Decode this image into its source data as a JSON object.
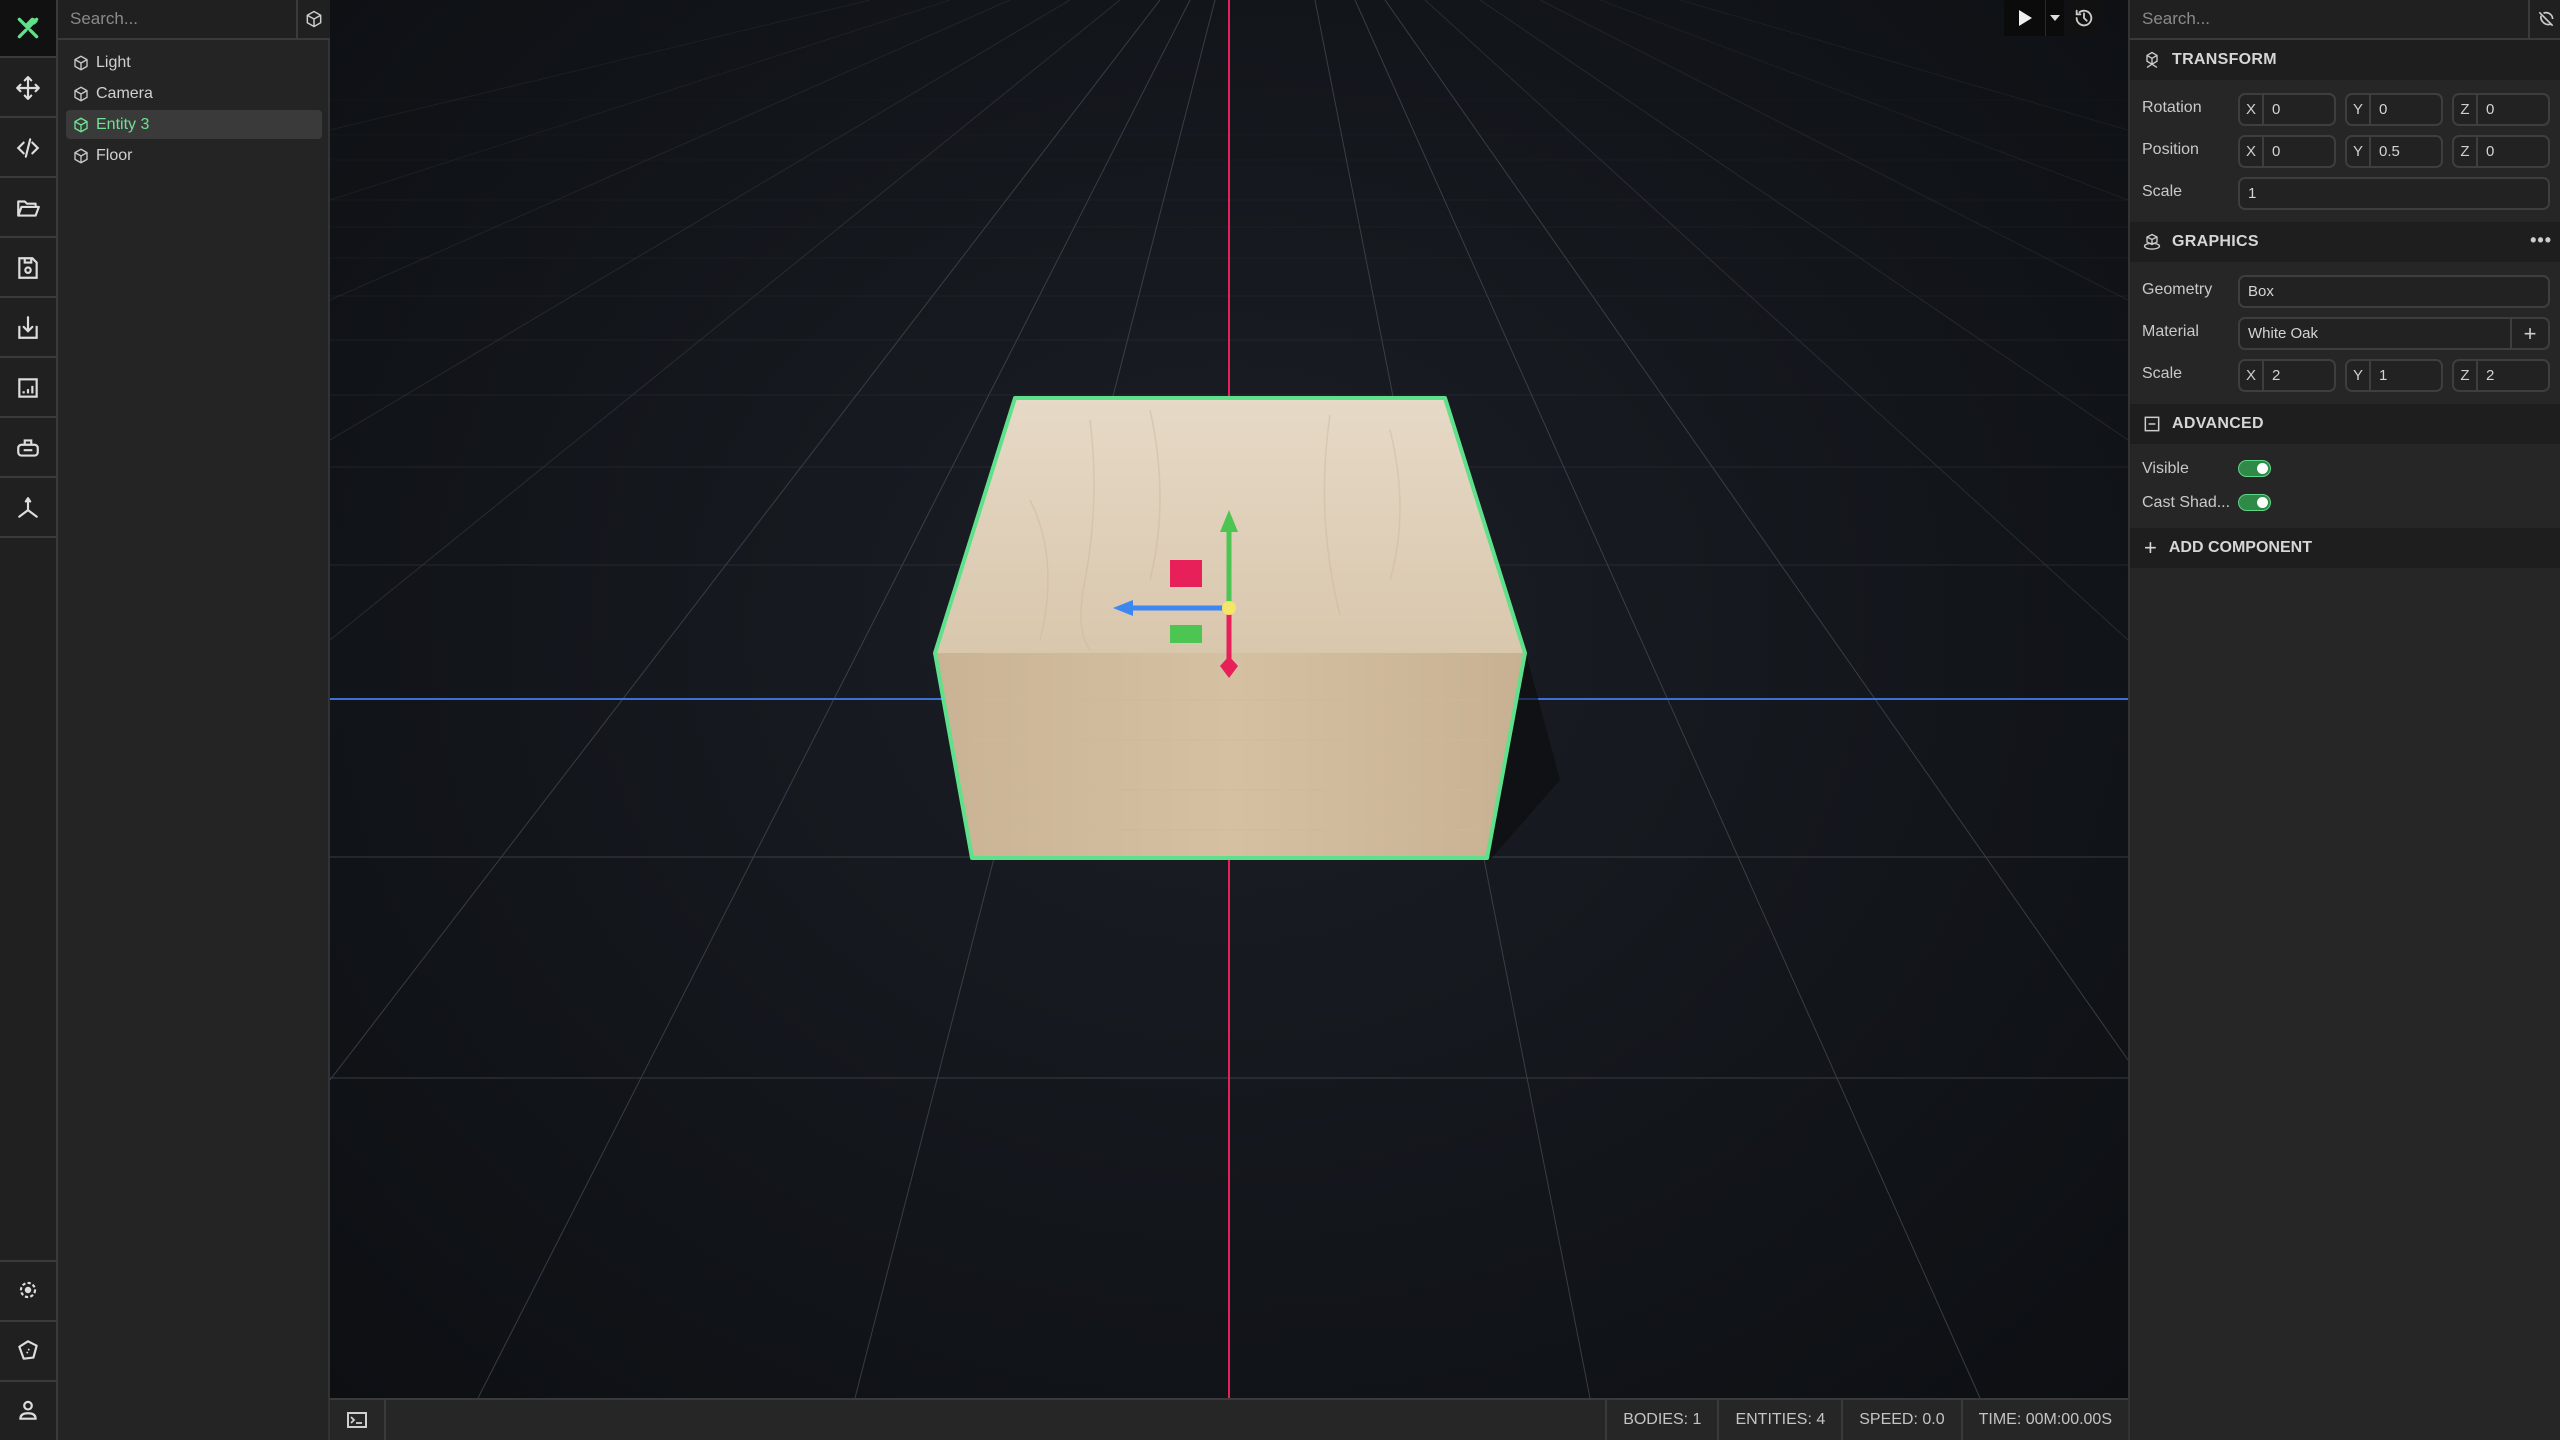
{
  "left_rail": {
    "top_items": [
      {
        "name": "build-tools",
        "icon": "hammer-wrench-icon",
        "active": true
      },
      {
        "name": "transform",
        "icon": "move-arrows-icon"
      },
      {
        "name": "code",
        "icon": "code-icon"
      },
      {
        "name": "open",
        "icon": "folder-open-icon"
      },
      {
        "name": "save",
        "icon": "floppy-disk-icon"
      },
      {
        "name": "import",
        "icon": "import-icon"
      },
      {
        "name": "stats",
        "icon": "chart-icon"
      },
      {
        "name": "vr",
        "icon": "vr-headset-icon"
      },
      {
        "name": "axes",
        "icon": "axes-icon"
      }
    ],
    "bottom_items": [
      {
        "name": "settings",
        "icon": "gear-icon"
      },
      {
        "name": "tag",
        "icon": "tag-icon"
      },
      {
        "name": "account",
        "icon": "user-icon"
      }
    ]
  },
  "hierarchy": {
    "search_placeholder": "Search...",
    "add_entity_icon": "cube-icon",
    "items": [
      {
        "label": "Light",
        "selected": false
      },
      {
        "label": "Camera",
        "selected": false
      },
      {
        "label": "Entity 3",
        "selected": true
      },
      {
        "label": "Floor",
        "selected": false
      }
    ]
  },
  "viewport": {
    "toolbar": {
      "play_icon": "play-icon",
      "dropdown_icon": "caret-down-icon",
      "history_icon": "history-icon"
    },
    "selected_object": "Entity 3",
    "colors": {
      "x_axis": "#e8205a",
      "y_axis": "#4cc552",
      "z_axis": "#3d87f0",
      "selection_outline": "#5fe08a",
      "center": "#f5e66a"
    }
  },
  "status_bar": {
    "terminal_icon": "terminal-icon",
    "stats": [
      {
        "label": "BODIES: 1"
      },
      {
        "label": "ENTITIES: 4"
      },
      {
        "label": "SPEED: 0.0"
      },
      {
        "label": "TIME: 00M:00.00S"
      }
    ]
  },
  "inspector": {
    "search_placeholder": "Search...",
    "visibility_icon": "eye-off-icon",
    "transform": {
      "title": "TRANSFORM",
      "rotation": {
        "label": "Rotation",
        "x": "0",
        "y": "0",
        "z": "0"
      },
      "position": {
        "label": "Position",
        "x": "0",
        "y": "0.5",
        "z": "0"
      },
      "scale": {
        "label": "Scale",
        "value": "1"
      }
    },
    "graphics": {
      "title": "GRAPHICS",
      "more": "•••",
      "geometry": {
        "label": "Geometry",
        "value": "Box"
      },
      "material": {
        "label": "Material",
        "value": "White Oak",
        "add": "+"
      },
      "scale": {
        "label": "Scale",
        "x": "2",
        "y": "1",
        "z": "2"
      }
    },
    "advanced": {
      "title": "ADVANCED",
      "visible": {
        "label": "Visible",
        "on": true
      },
      "cast_shadow": {
        "label": "Cast Shad...",
        "on": true
      }
    },
    "add_component": {
      "plus": "+",
      "label": "ADD COMPONENT"
    },
    "axis_labels": {
      "x": "X",
      "y": "Y",
      "z": "Z"
    },
    "accent": "#5fe08a"
  }
}
